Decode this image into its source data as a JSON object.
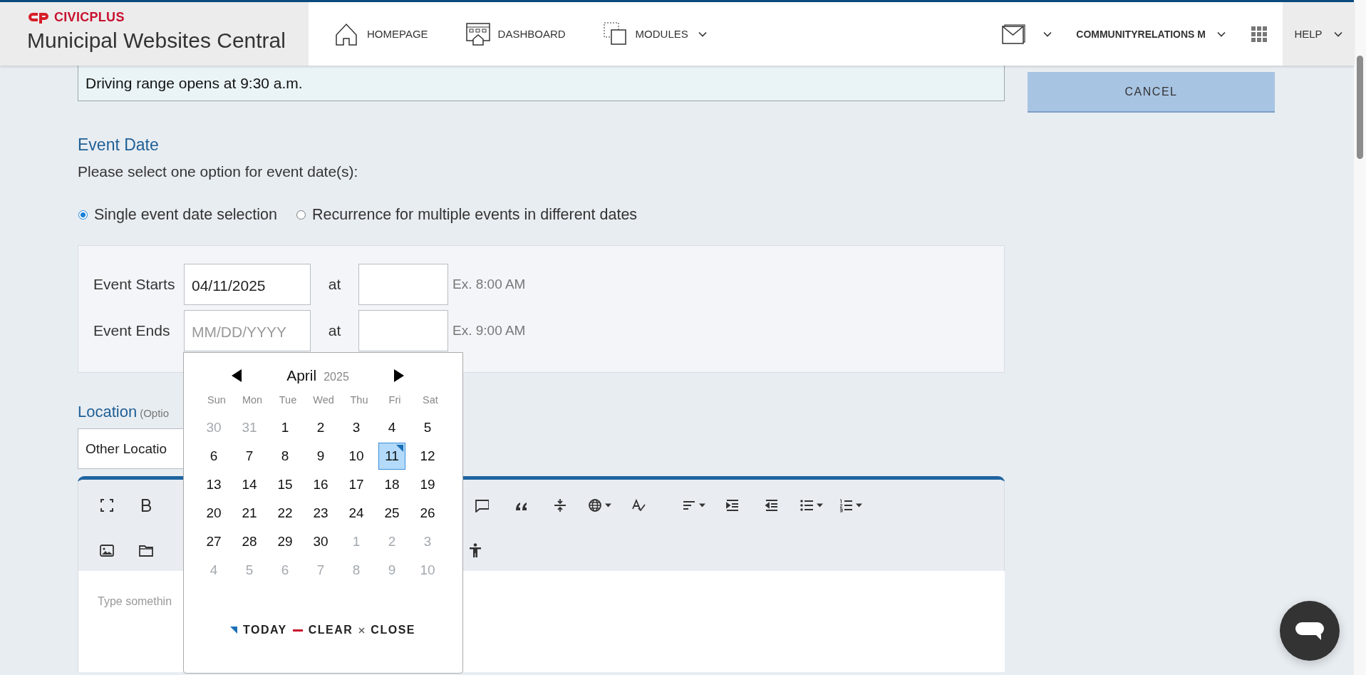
{
  "header": {
    "brand": "CIVICPLUS",
    "site_title": "Municipal Websites Central",
    "nav": [
      {
        "label": "HOMEPAGE",
        "kind": "home",
        "dropdown": false
      },
      {
        "label": "DASHBOARD",
        "kind": "dashboard",
        "dropdown": false
      },
      {
        "label": "MODULES",
        "kind": "modules",
        "dropdown": true
      }
    ],
    "user": "COMMUNITYRELATIONS M",
    "help": "HELP"
  },
  "notice": "Driving range opens at 9:30 a.m.",
  "event_date": {
    "heading": "Event Date",
    "prompt": "Please select one option for event date(s):",
    "options": [
      {
        "label": "Single event date selection",
        "selected": true
      },
      {
        "label": "Recurrence for multiple events in different dates",
        "selected": false
      }
    ],
    "rows": [
      {
        "label": "Event Starts",
        "date_value": "04/11/2025",
        "at": "at",
        "example": "Ex. 8:00 AM"
      },
      {
        "label": "Event Ends",
        "date_placeholder": "MM/DD/YYYY",
        "at": "at",
        "example": "Ex. 9:00 AM"
      }
    ]
  },
  "calendar": {
    "month": "April",
    "year": "2025",
    "weekdays": [
      "Sun",
      "Mon",
      "Tue",
      "Wed",
      "Thu",
      "Fri",
      "Sat"
    ],
    "days": [
      {
        "label": "30",
        "outside": true,
        "selected": false,
        "today": false
      },
      {
        "label": "31",
        "outside": true,
        "selected": false,
        "today": false
      },
      {
        "label": "1",
        "outside": false,
        "selected": false,
        "today": false
      },
      {
        "label": "2",
        "outside": false,
        "selected": false,
        "today": false
      },
      {
        "label": "3",
        "outside": false,
        "selected": false,
        "today": false
      },
      {
        "label": "4",
        "outside": false,
        "selected": false,
        "today": false
      },
      {
        "label": "5",
        "outside": false,
        "selected": false,
        "today": false
      },
      {
        "label": "6",
        "outside": false,
        "selected": false,
        "today": false
      },
      {
        "label": "7",
        "outside": false,
        "selected": false,
        "today": false
      },
      {
        "label": "8",
        "outside": false,
        "selected": false,
        "today": false
      },
      {
        "label": "9",
        "outside": false,
        "selected": false,
        "today": false
      },
      {
        "label": "10",
        "outside": false,
        "selected": false,
        "today": false
      },
      {
        "label": "11",
        "outside": false,
        "selected": true,
        "today": true
      },
      {
        "label": "12",
        "outside": false,
        "selected": false,
        "today": false
      },
      {
        "label": "13",
        "outside": false,
        "selected": false,
        "today": false
      },
      {
        "label": "14",
        "outside": false,
        "selected": false,
        "today": false
      },
      {
        "label": "15",
        "outside": false,
        "selected": false,
        "today": false
      },
      {
        "label": "16",
        "outside": false,
        "selected": false,
        "today": false
      },
      {
        "label": "17",
        "outside": false,
        "selected": false,
        "today": false
      },
      {
        "label": "18",
        "outside": false,
        "selected": false,
        "today": false
      },
      {
        "label": "19",
        "outside": false,
        "selected": false,
        "today": false
      },
      {
        "label": "20",
        "outside": false,
        "selected": false,
        "today": false
      },
      {
        "label": "21",
        "outside": false,
        "selected": false,
        "today": false
      },
      {
        "label": "22",
        "outside": false,
        "selected": false,
        "today": false
      },
      {
        "label": "23",
        "outside": false,
        "selected": false,
        "today": false
      },
      {
        "label": "24",
        "outside": false,
        "selected": false,
        "today": false
      },
      {
        "label": "25",
        "outside": false,
        "selected": false,
        "today": false
      },
      {
        "label": "26",
        "outside": false,
        "selected": false,
        "today": false
      },
      {
        "label": "27",
        "outside": false,
        "selected": false,
        "today": false
      },
      {
        "label": "28",
        "outside": false,
        "selected": false,
        "today": false
      },
      {
        "label": "29",
        "outside": false,
        "selected": false,
        "today": false
      },
      {
        "label": "30",
        "outside": false,
        "selected": false,
        "today": false
      },
      {
        "label": "1",
        "outside": true,
        "selected": false,
        "today": false
      },
      {
        "label": "2",
        "outside": true,
        "selected": false,
        "today": false
      },
      {
        "label": "3",
        "outside": true,
        "selected": false,
        "today": false
      },
      {
        "label": "4",
        "outside": true,
        "selected": false,
        "today": false
      },
      {
        "label": "5",
        "outside": true,
        "selected": false,
        "today": false
      },
      {
        "label": "6",
        "outside": true,
        "selected": false,
        "today": false
      },
      {
        "label": "7",
        "outside": true,
        "selected": false,
        "today": false
      },
      {
        "label": "8",
        "outside": true,
        "selected": false,
        "today": false
      },
      {
        "label": "9",
        "outside": true,
        "selected": false,
        "today": false
      },
      {
        "label": "10",
        "outside": true,
        "selected": false,
        "today": false
      }
    ],
    "footer": [
      {
        "label": "TODAY",
        "kind": "today"
      },
      {
        "label": "CLEAR",
        "kind": "clear"
      },
      {
        "label": "CLOSE",
        "kind": "close"
      }
    ]
  },
  "location": {
    "label": "Location",
    "hint": "(Optio",
    "value": "Other Locatio"
  },
  "editor": {
    "placeholder": "Type somethin"
  },
  "cancel": "CANCEL"
}
